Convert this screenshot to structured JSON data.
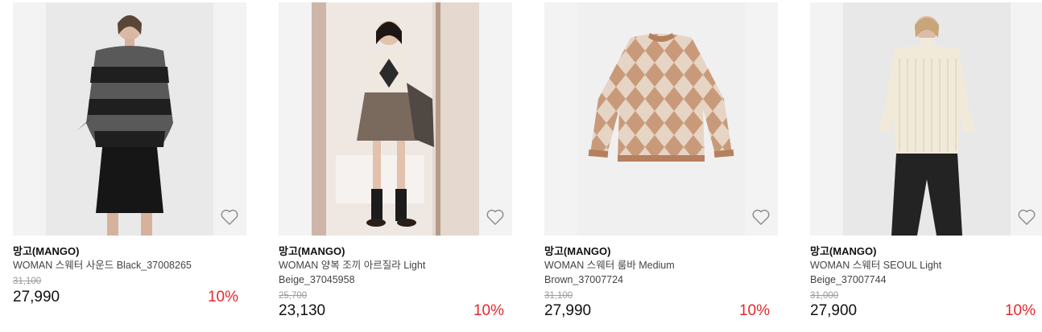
{
  "products": [
    {
      "brand": "망고(MANGO)",
      "name": "WOMAN 스웨터 사운드 Black_37008265",
      "original_price": "31,100",
      "price": "27,990",
      "discount": "10%"
    },
    {
      "brand": "망고(MANGO)",
      "name": "WOMAN 양복 조끼 아르질라 Light Beige_37045958",
      "original_price": "25,700",
      "price": "23,130",
      "discount": "10%"
    },
    {
      "brand": "망고(MANGO)",
      "name": "WOMAN 스웨터 룸바 Medium Brown_37007724",
      "original_price": "31,100",
      "price": "27,990",
      "discount": "10%"
    },
    {
      "brand": "망고(MANGO)",
      "name": "WOMAN 스웨터 SEOUL Light Beige_37007744",
      "original_price": "31,000",
      "price": "27,900",
      "discount": "10%"
    }
  ],
  "colors": {
    "discount": "#e8262c",
    "image_bg": "#f3f3f3",
    "strike": "#9a9a9a"
  },
  "icons": {
    "wishlist": "heart-outline-icon"
  }
}
